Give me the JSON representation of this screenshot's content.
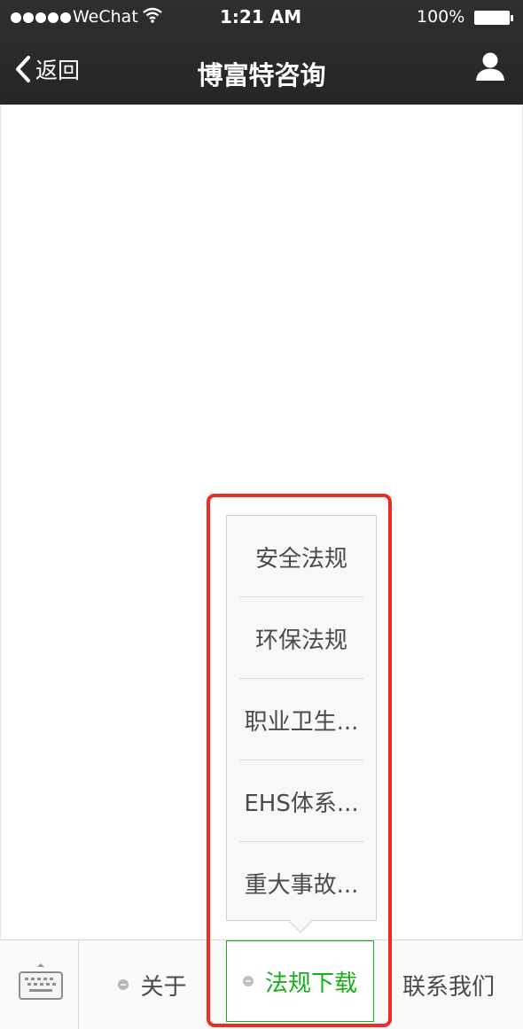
{
  "status_bar": {
    "carrier": "WeChat",
    "time": "1:21 AM",
    "battery": "100%"
  },
  "nav": {
    "back_label": "返回",
    "title": "博富特咨询"
  },
  "popup_menu": {
    "items": [
      "安全法规",
      "环保法规",
      "职业卫生...",
      "EHS体系...",
      "重大事故..."
    ]
  },
  "bottom_menu": {
    "items": [
      {
        "label": "关于"
      },
      {
        "label": "法规下载",
        "active": true
      },
      {
        "label": "联系我们"
      }
    ]
  },
  "colors": {
    "nav_background": "#2b2b2d",
    "active_accent": "#1aad19",
    "highlight_box": "#ee2e24"
  },
  "icons": [
    "signal-dots-icon",
    "wifi-icon",
    "battery-icon",
    "back-chevron-icon",
    "profile-icon",
    "keyboard-icon",
    "menu-dot-icon"
  ]
}
